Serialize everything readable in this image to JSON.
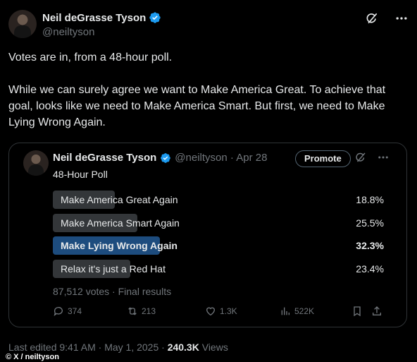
{
  "author": {
    "name": "Neil deGrasse Tyson",
    "handle": "@neiltyson"
  },
  "tweet": {
    "paragraph1": "Votes are in, from a 48-hour poll.",
    "paragraph2": "While we can surely agree we want to Make America Great. To achieve that goal, looks like we need to Make America Smart. But first, we need to Make Lying Wrong Again."
  },
  "quoted": {
    "name": "Neil deGrasse Tyson",
    "handle_date": "@neiltyson · Apr 28",
    "promote_label": "Promote",
    "poll_title": "48-Hour Poll",
    "options": [
      {
        "label": "Make America Great Again",
        "pct": "18.8%",
        "fraction": 0.188,
        "winner": false
      },
      {
        "label": "Make America Smart Again",
        "pct": "25.5%",
        "fraction": 0.255,
        "winner": false
      },
      {
        "label": "Make Lying Wrong Again",
        "pct": "32.3%",
        "fraction": 0.323,
        "winner": true
      },
      {
        "label": "Relax it's just a Red Hat",
        "pct": "23.4%",
        "fraction": 0.234,
        "winner": false
      }
    ],
    "votes_text": "87,512 votes · Final results",
    "actions": {
      "replies": "374",
      "reposts": "213",
      "likes": "1.3K",
      "views": "522K"
    }
  },
  "footer": {
    "edited": "Last edited 9:41 AM · May 1, 2025 · ",
    "views_count": "240.3K",
    "views_label": " Views"
  },
  "credit": "© X / neiltyson",
  "icons": {
    "verified": "verified-badge-icon",
    "grok": "grok-icon",
    "more": "more-icon"
  },
  "colors": {
    "verified": "#1d9bf0",
    "winner_bar": "#1d4c7e",
    "bar": "#333639",
    "muted": "#71767b"
  }
}
